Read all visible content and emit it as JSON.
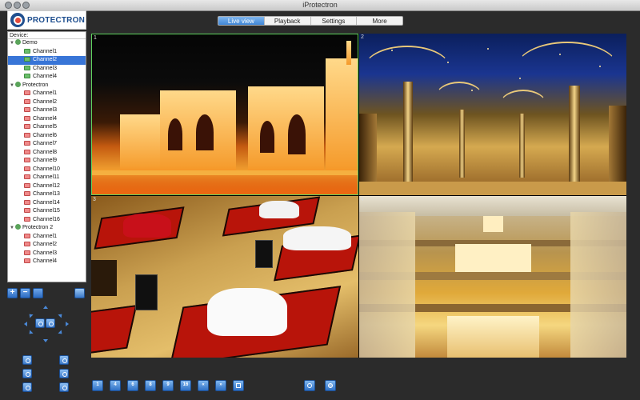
{
  "window": {
    "title": "iProtectron"
  },
  "logo": {
    "text": "PROTECTRON"
  },
  "tabs": [
    {
      "label": "Live view",
      "active": true
    },
    {
      "label": "Playback",
      "active": false
    },
    {
      "label": "Settings",
      "active": false
    },
    {
      "label": "More",
      "active": false
    }
  ],
  "device_panel": {
    "header": "Device:",
    "groups": [
      {
        "name": "Demo",
        "channels": [
          "Channel1",
          "Channel2",
          "Channel3",
          "Channel4"
        ],
        "selected_channel": "Channel2",
        "status_color": "#6cbf6c"
      },
      {
        "name": "Protectron",
        "channels": [
          "Channel1",
          "Channel2",
          "Channel3",
          "Channel4",
          "Channel5",
          "Channel6",
          "Channel7",
          "Channel8",
          "Channel9",
          "Channel10",
          "Channel11",
          "Channel12",
          "Channel13",
          "Channel14",
          "Channel15",
          "Channel16"
        ],
        "status_color": "#f08a8a"
      },
      {
        "name": "Protectron 2",
        "channels": [
          "Channel1",
          "Channel2",
          "Channel3",
          "Channel4"
        ],
        "status_color": "#f08a8a"
      }
    ]
  },
  "video": {
    "cells": [
      {
        "number": "1",
        "active": true
      },
      {
        "number": "2"
      },
      {
        "number": "3"
      },
      {
        "number": "4"
      }
    ],
    "active_border_color": "#5fd35f"
  },
  "controls": {
    "add_label": "+",
    "remove_label": "−"
  },
  "toolbar": {
    "layout_buttons": [
      "1",
      "4",
      "6",
      "8",
      "9",
      "16"
    ],
    "icons": [
      "prev-page-icon",
      "next-page-icon",
      "fullscreen-icon",
      "sequence-icon",
      "snapshot-icon",
      "record-icon"
    ]
  },
  "colors": {
    "accent": "#3f86d6",
    "selection": "#3875d7"
  }
}
